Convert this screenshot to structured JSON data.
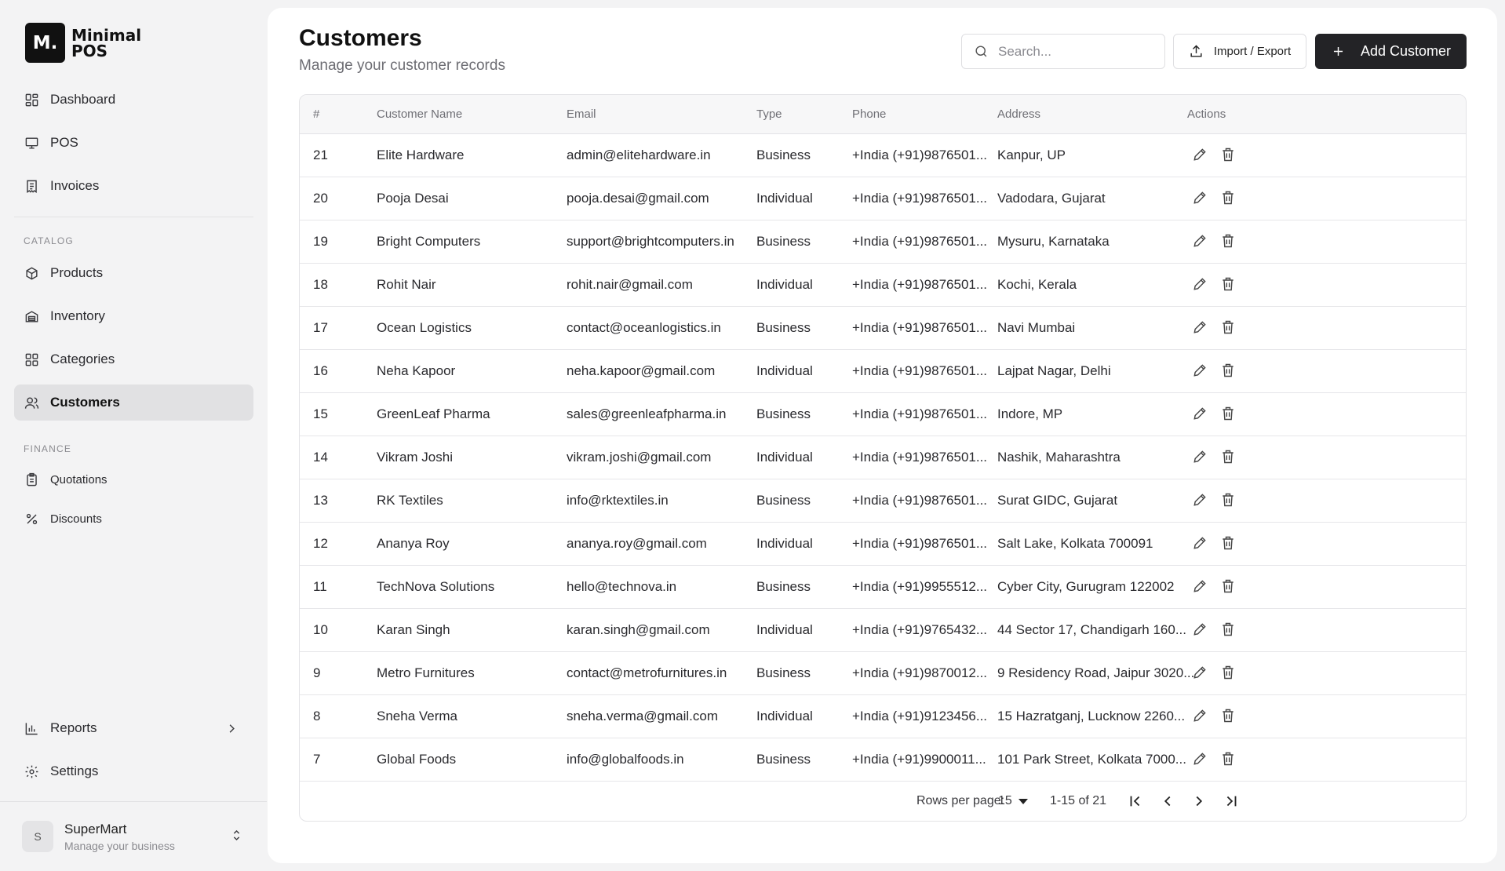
{
  "app": {
    "logo_mark": "M.",
    "logo_line1": "Minimal",
    "logo_line2": "POS"
  },
  "sidebar": {
    "main_items": [
      {
        "label": "Dashboard",
        "icon": "dashboard-icon"
      },
      {
        "label": "POS",
        "icon": "monitor-icon"
      },
      {
        "label": "Invoices",
        "icon": "invoice-icon"
      }
    ],
    "catalog_heading": "CATALOG",
    "catalog_items": [
      {
        "label": "Products",
        "icon": "box-icon"
      },
      {
        "label": "Inventory",
        "icon": "warehouse-icon"
      },
      {
        "label": "Categories",
        "icon": "grid-icon"
      },
      {
        "label": "Customers",
        "icon": "users-icon",
        "active": true
      }
    ],
    "finance_heading": "FINANCE",
    "finance_items": [
      {
        "label": "Quotations",
        "icon": "clipboard-icon"
      },
      {
        "label": "Discounts",
        "icon": "percent-icon"
      }
    ],
    "bottom_items": [
      {
        "label": "Reports",
        "icon": "bar-chart-icon"
      },
      {
        "label": "Settings",
        "icon": "gear-icon"
      }
    ],
    "user": {
      "initial": "S",
      "name": "SuperMart",
      "subtitle": "Manage your business"
    }
  },
  "header": {
    "title": "Customers",
    "subtitle": "Manage your customer records",
    "search_placeholder": "Search...",
    "import_export_label": "Import / Export",
    "add_label": "Add Customer"
  },
  "table": {
    "columns": [
      "#",
      "Customer Name",
      "Email",
      "Type",
      "Phone",
      "Address",
      "Actions"
    ],
    "rows": [
      {
        "id": "21",
        "name": "Elite Hardware",
        "email": "admin@elitehardware.in",
        "type": "Business",
        "phone": "+India (+91)9876501...",
        "address": "Kanpur, UP"
      },
      {
        "id": "20",
        "name": "Pooja Desai",
        "email": "pooja.desai@gmail.com",
        "type": "Individual",
        "phone": "+India (+91)9876501...",
        "address": "Vadodara, Gujarat"
      },
      {
        "id": "19",
        "name": "Bright Computers",
        "email": "support@brightcomputers.in",
        "type": "Business",
        "phone": "+India (+91)9876501...",
        "address": "Mysuru, Karnataka"
      },
      {
        "id": "18",
        "name": "Rohit Nair",
        "email": "rohit.nair@gmail.com",
        "type": "Individual",
        "phone": "+India (+91)9876501...",
        "address": "Kochi, Kerala"
      },
      {
        "id": "17",
        "name": "Ocean Logistics",
        "email": "contact@oceanlogistics.in",
        "type": "Business",
        "phone": "+India (+91)9876501...",
        "address": "Navi Mumbai"
      },
      {
        "id": "16",
        "name": "Neha Kapoor",
        "email": "neha.kapoor@gmail.com",
        "type": "Individual",
        "phone": "+India (+91)9876501...",
        "address": "Lajpat Nagar, Delhi"
      },
      {
        "id": "15",
        "name": "GreenLeaf Pharma",
        "email": "sales@greenleafpharma.in",
        "type": "Business",
        "phone": "+India (+91)9876501...",
        "address": "Indore, MP"
      },
      {
        "id": "14",
        "name": "Vikram Joshi",
        "email": "vikram.joshi@gmail.com",
        "type": "Individual",
        "phone": "+India (+91)9876501...",
        "address": "Nashik, Maharashtra"
      },
      {
        "id": "13",
        "name": "RK Textiles",
        "email": "info@rktextiles.in",
        "type": "Business",
        "phone": "+India (+91)9876501...",
        "address": "Surat GIDC, Gujarat"
      },
      {
        "id": "12",
        "name": "Ananya Roy",
        "email": "ananya.roy@gmail.com",
        "type": "Individual",
        "phone": "+India (+91)9876501...",
        "address": "Salt Lake, Kolkata 700091"
      },
      {
        "id": "11",
        "name": "TechNova Solutions",
        "email": "hello@technova.in",
        "type": "Business",
        "phone": "+India (+91)9955512...",
        "address": "Cyber City, Gurugram 122002"
      },
      {
        "id": "10",
        "name": "Karan Singh",
        "email": "karan.singh@gmail.com",
        "type": "Individual",
        "phone": "+India (+91)9765432...",
        "address": "44 Sector 17, Chandigarh 160..."
      },
      {
        "id": "9",
        "name": "Metro Furnitures",
        "email": "contact@metrofurnitures.in",
        "type": "Business",
        "phone": "+India (+91)9870012...",
        "address": "9 Residency Road, Jaipur 3020..."
      },
      {
        "id": "8",
        "name": "Sneha Verma",
        "email": "sneha.verma@gmail.com",
        "type": "Individual",
        "phone": "+India (+91)9123456...",
        "address": "15 Hazratganj, Lucknow 2260..."
      },
      {
        "id": "7",
        "name": "Global Foods",
        "email": "info@globalfoods.in",
        "type": "Business",
        "phone": "+India (+91)9900011...",
        "address": "101 Park Street, Kolkata 7000..."
      }
    ]
  },
  "pagination": {
    "rows_per_page_label": "Rows per page:",
    "rows_per_page_value": "15",
    "range_text": "1-15 of 21"
  }
}
